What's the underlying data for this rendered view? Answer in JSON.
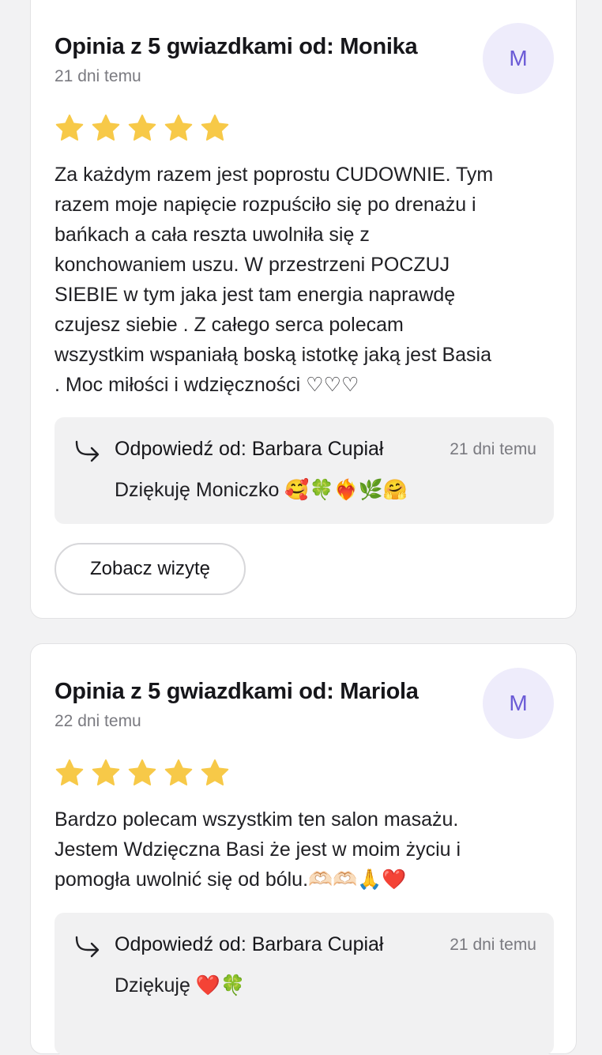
{
  "reviews": [
    {
      "title": "Opinia z 5 gwiazdkami od: Monika",
      "date": "21 dni temu",
      "avatar_initial": "M",
      "rating": 5,
      "text": "Za każdym razem jest poprostu CUDOWNIE. Tym\nrazem moje napięcie rozpuściło się po drenażu i\nbańkach a cała reszta uwolniła się z\nkonchowaniem uszu. W przestrzeni POCZUJ\nSIEBIE w tym jaka jest tam energia naprawdę\nczujesz siebie . Z całego serca polecam\nwszystkim wspaniałą boską istotkę jaką jest Basia\n. Moc miłości i wdzięczności ♡♡♡",
      "reply": {
        "author": "Odpowiedź od: Barbara Cupiał",
        "date": "21 dni temu",
        "text": "Dziękuję Moniczko 🥰🍀❤️‍🔥🌿🤗"
      },
      "button_label": "Zobacz wizytę"
    },
    {
      "title": "Opinia z 5 gwiazdkami od: Mariola",
      "date": "22 dni temu",
      "avatar_initial": "M",
      "rating": 5,
      "text": "Bardzo polecam wszystkim ten salon masażu.\nJestem Wdzięczna Basi że jest w moim życiu i\npomogła uwolnić się od bólu.🫶🏻🫶🏻🙏❤️",
      "reply": {
        "author": "Odpowiedź od: Barbara Cupiał",
        "date": "21 dni temu",
        "text": "Dziękuję ❤️🍀"
      }
    }
  ],
  "icons": {
    "star": "star-icon",
    "reply": "reply-arrow-icon"
  },
  "colors": {
    "star": "#f7c948",
    "avatar_bg": "#eeecfb",
    "avatar_text": "#6b5bd6",
    "reply_bg": "#f1f1f2"
  }
}
